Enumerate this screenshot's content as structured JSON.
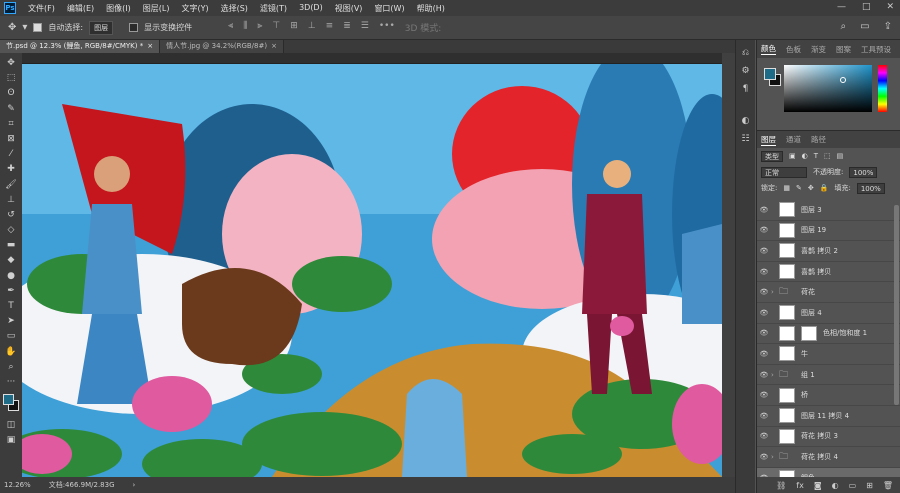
{
  "menu": {
    "logo": "Ps",
    "items": [
      "文件(F)",
      "编辑(E)",
      "图像(I)",
      "图层(L)",
      "文字(Y)",
      "选择(S)",
      "滤镜(T)",
      "3D(D)",
      "视图(V)",
      "窗口(W)",
      "帮助(H)"
    ],
    "window_buttons": [
      "—",
      "□",
      "✕"
    ]
  },
  "options": {
    "auto_select_label": "自动选择:",
    "auto_select_value": "图层",
    "show_transform_label": "显示变换控件",
    "mode_3d_label": "3D 模式:"
  },
  "tabs": [
    {
      "label": "节.psd @ 12.3% (鲤鱼, RGB/8#/CMYK) *",
      "close": "×",
      "active": true
    },
    {
      "label": "情人节.jpg @ 34.2%(RGB/8#)",
      "close": "×",
      "active": false
    }
  ],
  "status": {
    "zoom": "12.26%",
    "doc": "文档:466.9M/2.83G"
  },
  "color_panel": {
    "tabs": [
      "颜色",
      "色板",
      "渐变",
      "图案",
      "工具预设"
    ],
    "fg": "#1d6b86",
    "bg": "#111111"
  },
  "layers_panel": {
    "tabs": [
      "图层",
      "通道",
      "路径"
    ],
    "filter_label": "类型",
    "blend_mode": "正常",
    "opacity_label": "不透明度:",
    "opacity_value": "100%",
    "lock_label": "锁定:",
    "fill_label": "填充:",
    "fill_value": "100%",
    "layers": [
      {
        "name": "图层 3",
        "kind": "layer",
        "selected": false
      },
      {
        "name": "图层 19",
        "kind": "layer",
        "selected": false
      },
      {
        "name": "喜鹊 拷贝 2",
        "kind": "layer",
        "selected": false
      },
      {
        "name": "喜鹊 拷贝",
        "kind": "layer",
        "selected": false
      },
      {
        "name": "荷花",
        "kind": "group",
        "selected": false
      },
      {
        "name": "图层 4",
        "kind": "layer",
        "selected": false
      },
      {
        "name": "色相/饱和度 1",
        "kind": "adjustment",
        "selected": false
      },
      {
        "name": "牛",
        "kind": "layer",
        "selected": false
      },
      {
        "name": "组 1",
        "kind": "group",
        "selected": false
      },
      {
        "name": "桥",
        "kind": "layer",
        "selected": false
      },
      {
        "name": "图层 11 拷贝 4",
        "kind": "layer",
        "selected": false
      },
      {
        "name": "荷花 拷贝 3",
        "kind": "layer",
        "selected": false
      },
      {
        "name": "荷花 拷贝 4",
        "kind": "group",
        "selected": false
      },
      {
        "name": "鲤鱼",
        "kind": "layer",
        "selected": true
      }
    ],
    "footer_icons": [
      "link-icon",
      "fx-icon",
      "mask-icon",
      "adjustment-icon",
      "folder-icon",
      "new-layer-icon",
      "trash-icon"
    ]
  }
}
